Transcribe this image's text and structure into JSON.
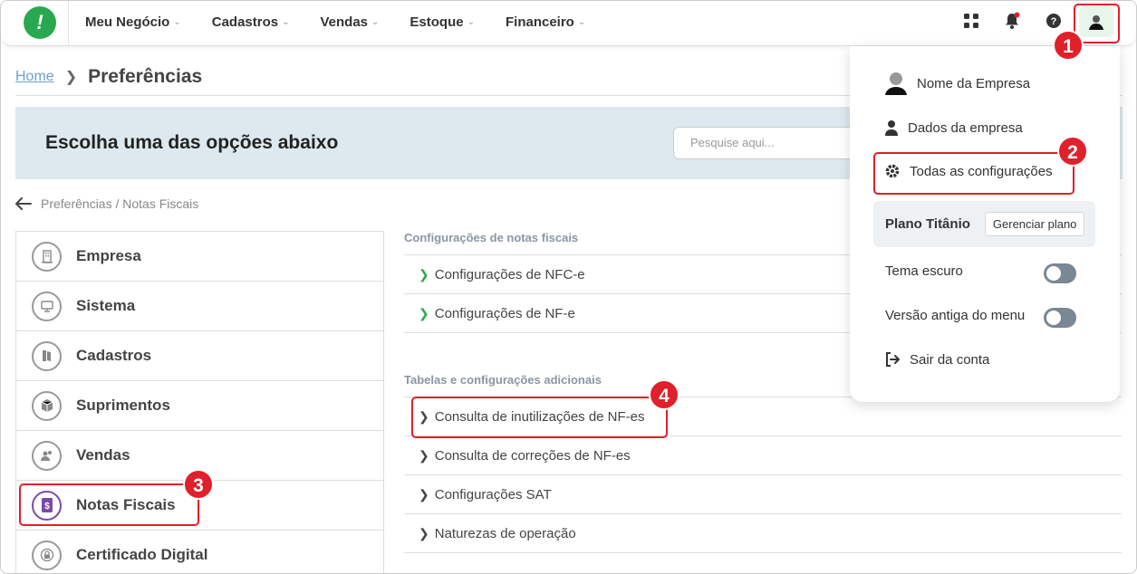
{
  "topbar": {
    "logo_text": "!",
    "nav": [
      {
        "label": "Meu Negócio"
      },
      {
        "label": "Cadastros"
      },
      {
        "label": "Vendas"
      },
      {
        "label": "Estoque"
      },
      {
        "label": "Financeiro"
      }
    ],
    "icons": [
      "apps-icon",
      "bell-icon",
      "help-icon",
      "user-avatar-icon"
    ]
  },
  "breadcrumb": {
    "home": "Home",
    "current": "Preferências"
  },
  "banner": {
    "title": "Escolha uma das opções abaixo",
    "search_placeholder": "Pesquise aqui..."
  },
  "subcrumb": "Preferências / Notas Fiscais",
  "left_menu": [
    {
      "label": "Empresa",
      "icon": "building-icon"
    },
    {
      "label": "Sistema",
      "icon": "monitor-icon"
    },
    {
      "label": "Cadastros",
      "icon": "book-icon"
    },
    {
      "label": "Suprimentos",
      "icon": "box-icon"
    },
    {
      "label": "Vendas",
      "icon": "people-icon"
    },
    {
      "label": "Notas Fiscais",
      "icon": "receipt-icon",
      "active": true
    },
    {
      "label": "Certificado Digital",
      "icon": "lock-icon"
    }
  ],
  "sections": [
    {
      "title": "Configurações de notas fiscais",
      "items": [
        "Configurações de NFC-e",
        "Configurações de NF-e"
      ]
    },
    {
      "title": "Tabelas e configurações adicionais",
      "items": [
        "Consulta de inutilizações de NF-es",
        "Consulta de correções de NF-es",
        "Configurações SAT",
        "Naturezas de operação"
      ]
    }
  ],
  "dropdown": {
    "company": "Nome da Empresa",
    "company_data": "Dados da empresa",
    "all_settings": "Todas as configurações",
    "plan_name": "Plano Titânio",
    "plan_button": "Gerenciar plano",
    "dark_mode": "Tema escuro",
    "old_menu": "Versão antiga do menu",
    "logout": "Sair da conta"
  },
  "badges": [
    "1",
    "2",
    "3",
    "4"
  ],
  "colors": {
    "accent": "#2aa84f",
    "highlight": "#e0202a",
    "banner": "#dde9ee",
    "active_icon": "#7b4aa8"
  }
}
